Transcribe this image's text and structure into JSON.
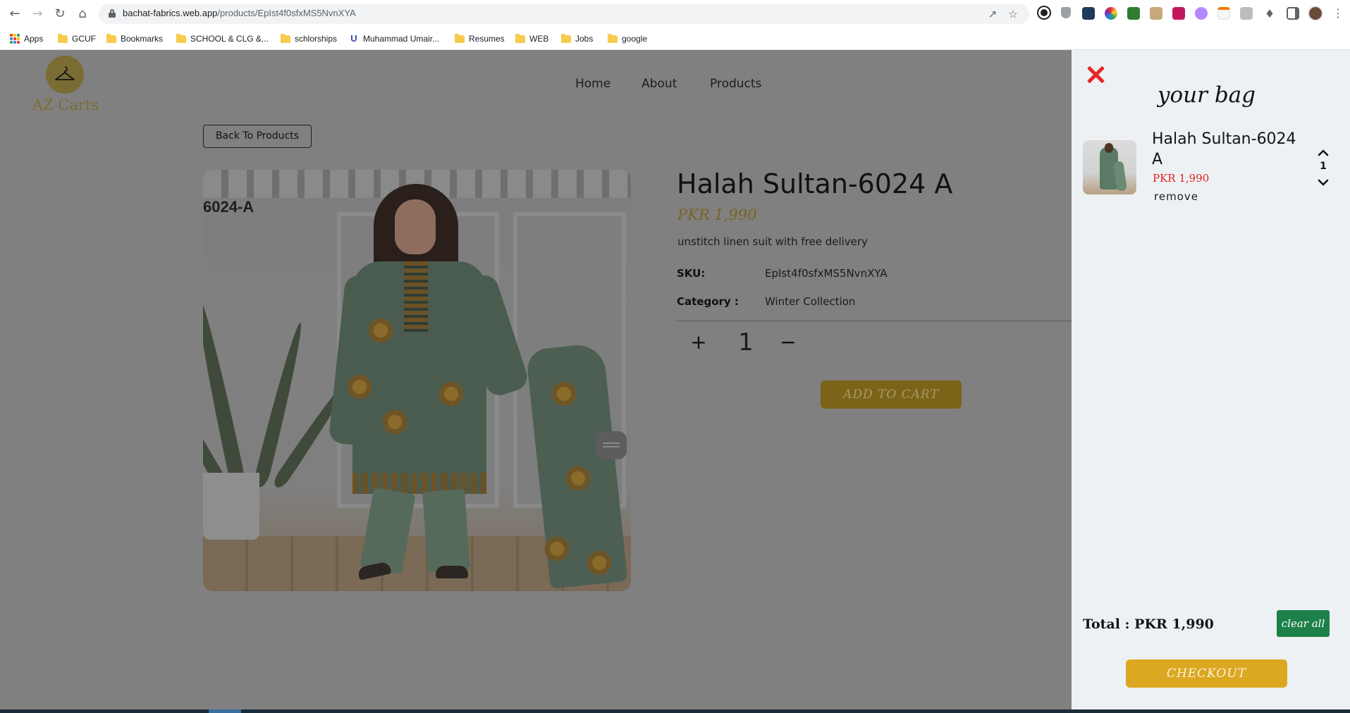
{
  "browser": {
    "url_host": "bachat-fabrics.web.app",
    "url_path": "/products/EpIst4f0sfxMS5NvnXYA",
    "bookmarks": [
      "Apps",
      "GCUF",
      "Bookmarks",
      "SCHOOL & CLG &...",
      "schlorships",
      "Muhammad Umair...",
      "Resumes",
      "WEB",
      "Jobs",
      "google"
    ]
  },
  "site": {
    "logo_text": "AZ Carts",
    "nav": [
      "Home",
      "About",
      "Products"
    ],
    "back_label": "Back To Products"
  },
  "product": {
    "image_tag": "6024-A",
    "title": "Halah Sultan-6024 A",
    "price": "PKR 1,990",
    "description": "unstitch linen suit with free delivery",
    "sku_label": "SKU:",
    "sku": "EpIst4f0sfxMS5NvnXYA",
    "category_label": "Category :",
    "category": "Winter Collection",
    "qty_plus": "+",
    "quantity": "1",
    "qty_minus": "−",
    "add_to_cart": "ADD TO CART"
  },
  "cart": {
    "title": "your bag",
    "items": [
      {
        "name": "Halah Sultan-6024 A",
        "price": "PKR 1,990",
        "quantity": "1",
        "remove_label": "remove"
      }
    ],
    "total": "Total : PKR 1,990",
    "clear_label": "clear all",
    "checkout_label": "CHECKOUT"
  },
  "colors": {
    "accent_gold": "#dca821",
    "clear_green": "#1c8048",
    "close_red": "#e32626",
    "overlay_gray": "#808080"
  }
}
